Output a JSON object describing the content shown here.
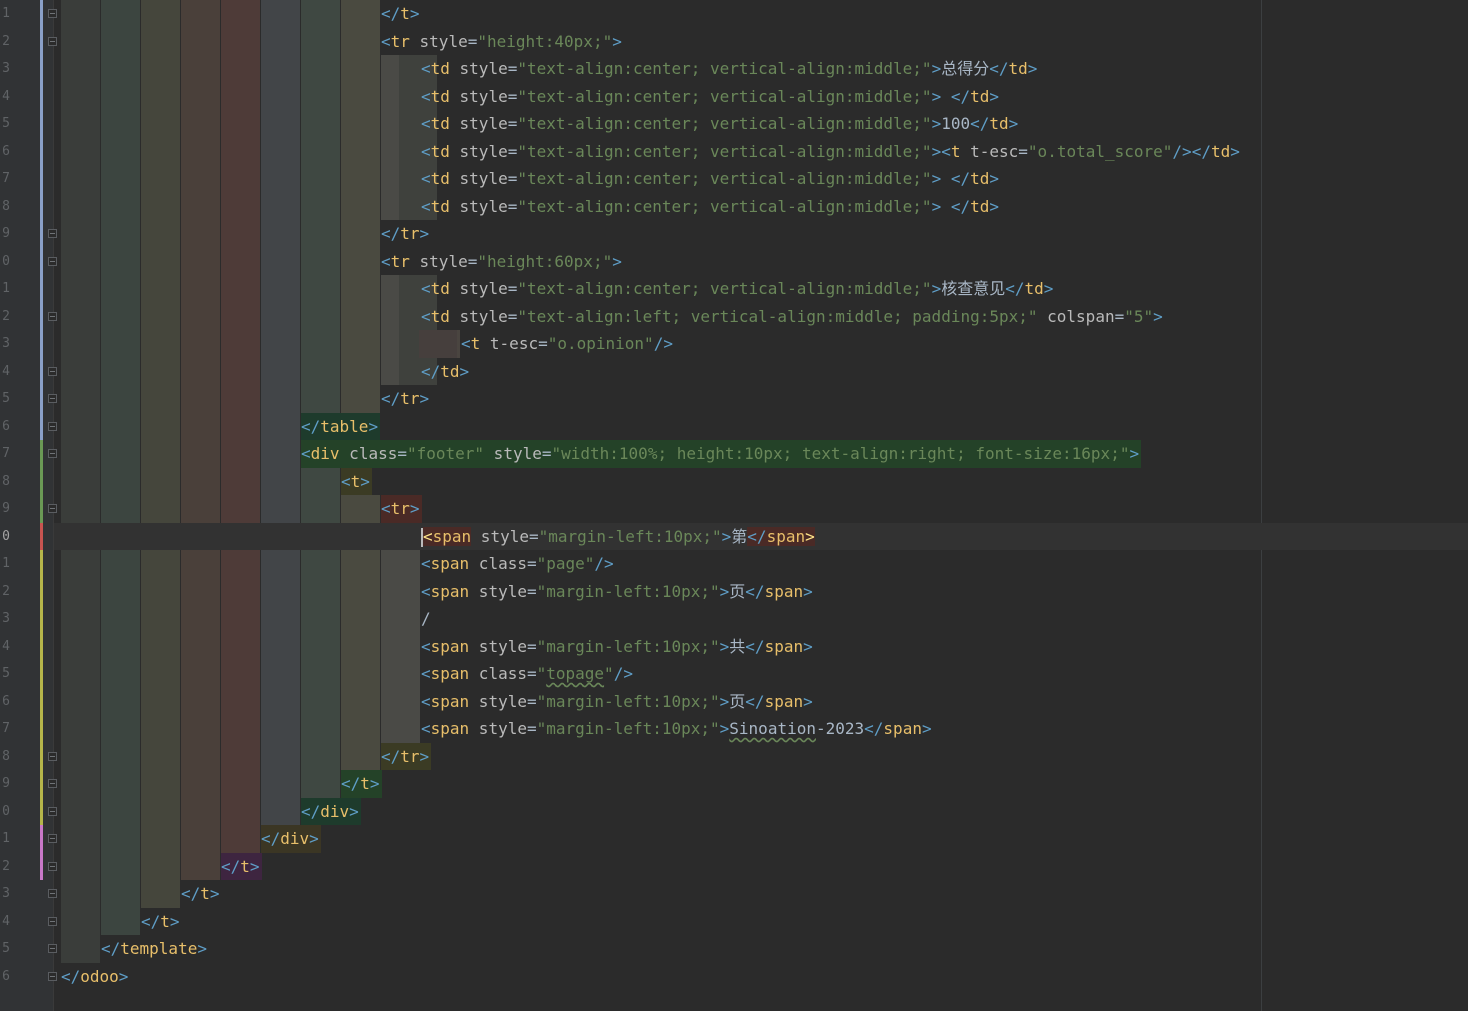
{
  "editor": {
    "colors": {
      "background": "#2b2b2b",
      "gutter": "#313335",
      "tag_bracket": "#e8bf6a",
      "attribute_name": "#bababa",
      "attribute_value": "#6a8759",
      "plain_text": "#a9b7c6",
      "t_tag": "#e8bf6a",
      "td_tag": "#e8bf6a"
    },
    "line_numbers": [
      "1",
      "2",
      "3",
      "4",
      "5",
      "6",
      "7",
      "8",
      "9",
      "0",
      "1",
      "2",
      "3",
      "4",
      "5",
      "6",
      "7",
      "8",
      "9",
      "0",
      "1",
      "2",
      "3",
      "4",
      "5",
      "6",
      "7",
      "8",
      "9",
      "0",
      "1",
      "2",
      "3",
      "4",
      "5",
      "6"
    ],
    "caret_line_index": 19,
    "lines": [
      {
        "tokens": [
          {
            "t": "</",
            "c": "p"
          },
          {
            "t": "t",
            "c": "tg"
          },
          {
            "t": ">",
            "c": "p"
          }
        ]
      },
      {
        "tokens": [
          {
            "t": "<",
            "c": "p"
          },
          {
            "t": "tr",
            "c": "tg"
          },
          {
            "t": " style",
            "c": "an"
          },
          {
            "t": "=",
            "c": "pl"
          },
          {
            "t": "\"height:40px;\"",
            "c": "av"
          },
          {
            "t": ">",
            "c": "p"
          }
        ]
      },
      {
        "tokens": [
          {
            "t": "<",
            "c": "p"
          },
          {
            "t": "td",
            "c": "tg"
          },
          {
            "t": " style",
            "c": "an"
          },
          {
            "t": "=",
            "c": "pl"
          },
          {
            "t": "\"text-align:center; vertical-align:middle;\"",
            "c": "av"
          },
          {
            "t": ">",
            "c": "p"
          },
          {
            "t": "总得分",
            "c": "pl"
          },
          {
            "t": "</",
            "c": "p"
          },
          {
            "t": "td",
            "c": "tg"
          },
          {
            "t": ">",
            "c": "p"
          }
        ]
      },
      {
        "tokens": [
          {
            "t": "<",
            "c": "p"
          },
          {
            "t": "td",
            "c": "tg"
          },
          {
            "t": " style",
            "c": "an"
          },
          {
            "t": "=",
            "c": "pl"
          },
          {
            "t": "\"text-align:center; vertical-align:middle;\"",
            "c": "av"
          },
          {
            "t": ">",
            "c": "p"
          },
          {
            "t": " ",
            "c": "pl"
          },
          {
            "t": "</",
            "c": "p"
          },
          {
            "t": "td",
            "c": "tg"
          },
          {
            "t": ">",
            "c": "p"
          }
        ]
      },
      {
        "tokens": [
          {
            "t": "<",
            "c": "p"
          },
          {
            "t": "td",
            "c": "tg"
          },
          {
            "t": " style",
            "c": "an"
          },
          {
            "t": "=",
            "c": "pl"
          },
          {
            "t": "\"text-align:center; vertical-align:middle;\"",
            "c": "av"
          },
          {
            "t": ">",
            "c": "p"
          },
          {
            "t": "100",
            "c": "pl"
          },
          {
            "t": "</",
            "c": "p"
          },
          {
            "t": "td",
            "c": "tg"
          },
          {
            "t": ">",
            "c": "p"
          }
        ]
      },
      {
        "tokens": [
          {
            "t": "<",
            "c": "p"
          },
          {
            "t": "td",
            "c": "tg"
          },
          {
            "t": " style",
            "c": "an"
          },
          {
            "t": "=",
            "c": "pl"
          },
          {
            "t": "\"text-align:center; vertical-align:middle;\"",
            "c": "av"
          },
          {
            "t": ">",
            "c": "p"
          },
          {
            "t": "<",
            "c": "p"
          },
          {
            "t": "t",
            "c": "tg"
          },
          {
            "t": " t-esc",
            "c": "an"
          },
          {
            "t": "=",
            "c": "pl"
          },
          {
            "t": "\"o.total_score\"",
            "c": "av"
          },
          {
            "t": "/>",
            "c": "p"
          },
          {
            "t": "</",
            "c": "p"
          },
          {
            "t": "td",
            "c": "tg"
          },
          {
            "t": ">",
            "c": "p"
          }
        ]
      },
      {
        "tokens": [
          {
            "t": "<",
            "c": "p"
          },
          {
            "t": "td",
            "c": "tg"
          },
          {
            "t": " style",
            "c": "an"
          },
          {
            "t": "=",
            "c": "pl"
          },
          {
            "t": "\"text-align:center; vertical-align:middle;\"",
            "c": "av"
          },
          {
            "t": ">",
            "c": "p"
          },
          {
            "t": " ",
            "c": "pl"
          },
          {
            "t": "</",
            "c": "p"
          },
          {
            "t": "td",
            "c": "tg"
          },
          {
            "t": ">",
            "c": "p"
          }
        ]
      },
      {
        "tokens": [
          {
            "t": "<",
            "c": "p"
          },
          {
            "t": "td",
            "c": "tg"
          },
          {
            "t": " style",
            "c": "an"
          },
          {
            "t": "=",
            "c": "pl"
          },
          {
            "t": "\"text-align:center; vertical-align:middle;\"",
            "c": "av"
          },
          {
            "t": ">",
            "c": "p"
          },
          {
            "t": " ",
            "c": "pl"
          },
          {
            "t": "</",
            "c": "p"
          },
          {
            "t": "td",
            "c": "tg"
          },
          {
            "t": ">",
            "c": "p"
          }
        ]
      },
      {
        "tokens": [
          {
            "t": "</",
            "c": "p"
          },
          {
            "t": "tr",
            "c": "tg"
          },
          {
            "t": ">",
            "c": "p"
          }
        ]
      },
      {
        "tokens": [
          {
            "t": "<",
            "c": "p"
          },
          {
            "t": "tr",
            "c": "tg"
          },
          {
            "t": " style",
            "c": "an"
          },
          {
            "t": "=",
            "c": "pl"
          },
          {
            "t": "\"height:60px;\"",
            "c": "av"
          },
          {
            "t": ">",
            "c": "p"
          }
        ]
      },
      {
        "tokens": [
          {
            "t": "<",
            "c": "p"
          },
          {
            "t": "td",
            "c": "tg"
          },
          {
            "t": " style",
            "c": "an"
          },
          {
            "t": "=",
            "c": "pl"
          },
          {
            "t": "\"text-align:center; vertical-align:middle;\"",
            "c": "av"
          },
          {
            "t": ">",
            "c": "p"
          },
          {
            "t": "核查意见",
            "c": "pl"
          },
          {
            "t": "</",
            "c": "p"
          },
          {
            "t": "td",
            "c": "tg"
          },
          {
            "t": ">",
            "c": "p"
          }
        ]
      },
      {
        "tokens": [
          {
            "t": "<",
            "c": "p"
          },
          {
            "t": "td",
            "c": "tg"
          },
          {
            "t": " style",
            "c": "an"
          },
          {
            "t": "=",
            "c": "pl"
          },
          {
            "t": "\"text-align:left; vertical-align:middle; padding:5px;\"",
            "c": "av"
          },
          {
            "t": " colspan",
            "c": "an"
          },
          {
            "t": "=",
            "c": "pl"
          },
          {
            "t": "\"5\"",
            "c": "av"
          },
          {
            "t": ">",
            "c": "p"
          }
        ]
      },
      {
        "tokens": [
          {
            "t": "<",
            "c": "p"
          },
          {
            "t": "t",
            "c": "tg"
          },
          {
            "t": " t-esc",
            "c": "an"
          },
          {
            "t": "=",
            "c": "pl"
          },
          {
            "t": "\"o.opinion\"",
            "c": "av"
          },
          {
            "t": "/>",
            "c": "p"
          }
        ]
      },
      {
        "tokens": [
          {
            "t": "</",
            "c": "p"
          },
          {
            "t": "td",
            "c": "tg"
          },
          {
            "t": ">",
            "c": "p"
          }
        ]
      },
      {
        "tokens": [
          {
            "t": "</",
            "c": "p"
          },
          {
            "t": "tr",
            "c": "tg"
          },
          {
            "t": ">",
            "c": "p"
          }
        ]
      },
      {
        "tokens": [
          {
            "t": "</",
            "c": "p"
          },
          {
            "t": "table",
            "c": "tg"
          },
          {
            "t": ">",
            "c": "p"
          }
        ]
      },
      {
        "tokens": [
          {
            "t": "<",
            "c": "p"
          },
          {
            "t": "div",
            "c": "tg"
          },
          {
            "t": " class",
            "c": "an"
          },
          {
            "t": "=",
            "c": "pl"
          },
          {
            "t": "\"footer\"",
            "c": "av"
          },
          {
            "t": " style",
            "c": "an"
          },
          {
            "t": "=",
            "c": "pl"
          },
          {
            "t": "\"width:100%; height:10px; text-align:right; font-size:16px;\"",
            "c": "av"
          },
          {
            "t": ">",
            "c": "p"
          }
        ]
      },
      {
        "tokens": [
          {
            "t": "<",
            "c": "p"
          },
          {
            "t": "t",
            "c": "tg"
          },
          {
            "t": ">",
            "c": "p"
          }
        ]
      },
      {
        "tokens": [
          {
            "t": "<",
            "c": "p"
          },
          {
            "t": "tr",
            "c": "tg"
          },
          {
            "t": ">",
            "c": "p"
          }
        ]
      },
      {
        "tokens": [
          {
            "t": "<",
            "c": "p"
          },
          {
            "t": "span",
            "c": "tg"
          },
          {
            "t": " style",
            "c": "an"
          },
          {
            "t": "=",
            "c": "pl"
          },
          {
            "t": "\"margin-left:10px;\"",
            "c": "av"
          },
          {
            "t": ">",
            "c": "p"
          },
          {
            "t": "第",
            "c": "pl"
          },
          {
            "t": "</",
            "c": "p"
          },
          {
            "t": "span",
            "c": "tg"
          },
          {
            "t": ">",
            "c": "p"
          }
        ]
      },
      {
        "tokens": [
          {
            "t": "<",
            "c": "p"
          },
          {
            "t": "span",
            "c": "tg"
          },
          {
            "t": " class",
            "c": "an"
          },
          {
            "t": "=",
            "c": "pl"
          },
          {
            "t": "\"page\"",
            "c": "av"
          },
          {
            "t": "/>",
            "c": "p"
          }
        ]
      },
      {
        "tokens": [
          {
            "t": "<",
            "c": "p"
          },
          {
            "t": "span",
            "c": "tg"
          },
          {
            "t": " style",
            "c": "an"
          },
          {
            "t": "=",
            "c": "pl"
          },
          {
            "t": "\"margin-left:10px;\"",
            "c": "av"
          },
          {
            "t": ">",
            "c": "p"
          },
          {
            "t": "页",
            "c": "pl"
          },
          {
            "t": "</",
            "c": "p"
          },
          {
            "t": "span",
            "c": "tg"
          },
          {
            "t": ">",
            "c": "p"
          }
        ]
      },
      {
        "tokens": [
          {
            "t": "/",
            "c": "pl"
          }
        ]
      },
      {
        "tokens": [
          {
            "t": "<",
            "c": "p"
          },
          {
            "t": "span",
            "c": "tg"
          },
          {
            "t": " style",
            "c": "an"
          },
          {
            "t": "=",
            "c": "pl"
          },
          {
            "t": "\"margin-left:10px;\"",
            "c": "av"
          },
          {
            "t": ">",
            "c": "p"
          },
          {
            "t": "共",
            "c": "pl"
          },
          {
            "t": "</",
            "c": "p"
          },
          {
            "t": "span",
            "c": "tg"
          },
          {
            "t": ">",
            "c": "p"
          }
        ]
      },
      {
        "tokens": [
          {
            "t": "<",
            "c": "p"
          },
          {
            "t": "span",
            "c": "tg"
          },
          {
            "t": " class",
            "c": "an"
          },
          {
            "t": "=",
            "c": "pl"
          },
          {
            "t": "\"",
            "c": "av"
          },
          {
            "t": "topage",
            "c": "avw"
          },
          {
            "t": "\"",
            "c": "av"
          },
          {
            "t": "/>",
            "c": "p"
          }
        ]
      },
      {
        "tokens": [
          {
            "t": "<",
            "c": "p"
          },
          {
            "t": "span",
            "c": "tg"
          },
          {
            "t": " style",
            "c": "an"
          },
          {
            "t": "=",
            "c": "pl"
          },
          {
            "t": "\"margin-left:10px;\"",
            "c": "av"
          },
          {
            "t": ">",
            "c": "p"
          },
          {
            "t": "页",
            "c": "pl"
          },
          {
            "t": "</",
            "c": "p"
          },
          {
            "t": "span",
            "c": "tg"
          },
          {
            "t": ">",
            "c": "p"
          }
        ]
      },
      {
        "tokens": [
          {
            "t": "<",
            "c": "p"
          },
          {
            "t": "span",
            "c": "tg"
          },
          {
            "t": " style",
            "c": "an"
          },
          {
            "t": "=",
            "c": "pl"
          },
          {
            "t": "\"margin-left:10px;\"",
            "c": "av"
          },
          {
            "t": ">",
            "c": "p"
          },
          {
            "t": "Sinoation",
            "c": "plw"
          },
          {
            "t": "-2023",
            "c": "pl"
          },
          {
            "t": "</",
            "c": "p"
          },
          {
            "t": "span",
            "c": "tg"
          },
          {
            "t": ">",
            "c": "p"
          }
        ]
      },
      {
        "tokens": [
          {
            "t": "</",
            "c": "p"
          },
          {
            "t": "tr",
            "c": "tg"
          },
          {
            "t": ">",
            "c": "p"
          }
        ]
      },
      {
        "tokens": [
          {
            "t": "</",
            "c": "p"
          },
          {
            "t": "t",
            "c": "tg"
          },
          {
            "t": ">",
            "c": "p"
          }
        ]
      },
      {
        "tokens": [
          {
            "t": "</",
            "c": "p"
          },
          {
            "t": "div",
            "c": "tg"
          },
          {
            "t": ">",
            "c": "p"
          }
        ]
      },
      {
        "tokens": [
          {
            "t": "</",
            "c": "p"
          },
          {
            "t": "div",
            "c": "tg"
          },
          {
            "t": ">",
            "c": "p"
          }
        ]
      },
      {
        "tokens": [
          {
            "t": "</",
            "c": "p"
          },
          {
            "t": "t",
            "c": "tg"
          },
          {
            "t": ">",
            "c": "p"
          }
        ]
      },
      {
        "tokens": [
          {
            "t": "</",
            "c": "p"
          },
          {
            "t": "t",
            "c": "tg"
          },
          {
            "t": ">",
            "c": "p"
          }
        ]
      },
      {
        "tokens": [
          {
            "t": "</",
            "c": "p"
          },
          {
            "t": "t",
            "c": "tg"
          },
          {
            "t": ">",
            "c": "p"
          }
        ]
      },
      {
        "tokens": [
          {
            "t": "</",
            "c": "p"
          },
          {
            "t": "template",
            "c": "tg"
          },
          {
            "t": ">",
            "c": "p"
          }
        ]
      },
      {
        "tokens": [
          {
            "t": "</",
            "c": "p"
          },
          {
            "t": "odoo",
            "c": "tg"
          },
          {
            "t": ">",
            "c": "p"
          }
        ]
      }
    ]
  }
}
